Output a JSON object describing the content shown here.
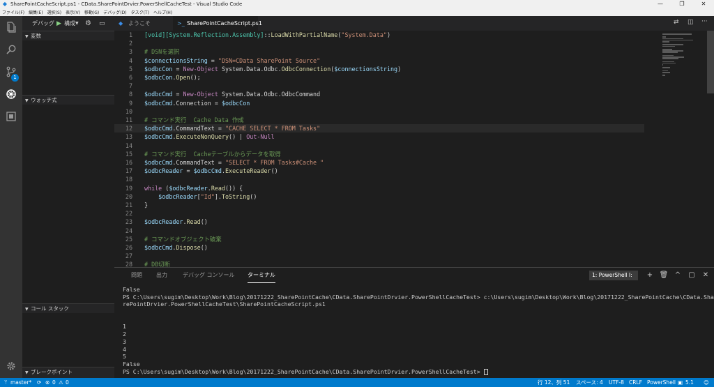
{
  "window": {
    "title": "SharePointCacheScript.ps1 - CData.SharePointDrvier.PowerShellCacheTest - Visual Studio Code",
    "minimize": "—",
    "maximize": "❐",
    "close": "✕"
  },
  "menu": [
    "ファイル(F)",
    "編集(E)",
    "選択(S)",
    "表示(V)",
    "移動(G)",
    "デバッグ(D)",
    "タスク(T)",
    "ヘルプ(H)"
  ],
  "activity": {
    "scm_badge": "1"
  },
  "sidebar": {
    "debug_label": "デバッグ",
    "config": "構成",
    "sections": {
      "variables": "変数",
      "watch": "ウォッチ式",
      "callstack": "コール スタック",
      "breakpoints": "ブレークポイント"
    }
  },
  "tabs": [
    {
      "label": "ようこそ",
      "active": false
    },
    {
      "label": "SharePointCacheScript.ps1",
      "active": true
    }
  ],
  "code": [
    "[void][System.Reflection.Assembly]::LoadWithPartialName(\"System.Data\")",
    "",
    "# DSNを選択",
    "$connectionsString = \"DSN=CData SharePoint Source\"",
    "$odbcCon = New-Object System.Data.Odbc.OdbcConnection($connectionsString)",
    "$odbcCon.Open();",
    "",
    "$odbcCmd = New-Object System.Data.Odbc.OdbcCommand",
    "$odbcCmd.Connection = $odbcCon",
    "",
    "# コマンド実行  Cache Data 作成",
    "$odbcCmd.CommandText = \"CACHE SELECT * FROM Tasks\"",
    "$odbcCmd.ExecuteNonQuery() | Out-Null",
    "",
    "# コマンド実行  Cacheテーブルからデータを取得",
    "$odbcCmd.CommandText = \"SELECT * FROM Tasks#Cache \"",
    "$odbcReader = $odbcCmd.ExecuteReader()",
    "",
    "while ($odbcReader.Read()) {",
    "    $odbcReader[\"Id\"].ToString()",
    "}",
    "",
    "$odbcReader.Read()",
    "",
    "# コマンドオブジェクト破棄",
    "$odbcCmd.Dispose()",
    "",
    "# DB切断"
  ],
  "panel": {
    "tabs": [
      "問題",
      "出力",
      "デバッグ コンソール",
      "ターミナル"
    ],
    "terminal_select": "1: PowerShell I:",
    "terminal_lines": [
      "False",
      "PS C:\\Users\\sugim\\Desktop\\Work\\Blog\\20171222_SharePointCache\\CData.SharePointDrvier.PowerShellCacheTest> c:\\Users\\sugim\\Desktop\\Work\\Blog\\20171222_SharePointCache\\CData.Sha",
      "rePointDrvier.PowerShellCacheTest\\SharePointCacheScript.ps1",
      "",
      "",
      "1",
      "2",
      "3",
      "4",
      "5",
      "False",
      "PS C:\\Users\\sugim\\Desktop\\Work\\Blog\\20171222_SharePointCache\\CData.SharePointDrvier.PowerShellCacheTest> "
    ]
  },
  "status": {
    "branch": "master*",
    "sync": "⟳",
    "errors": "0",
    "warnings": "0",
    "position": "行 12、列 51",
    "spaces": "スペース: 4",
    "encoding": "UTF-8",
    "eol": "CRLF",
    "language": "PowerShell",
    "version": "5.1"
  }
}
